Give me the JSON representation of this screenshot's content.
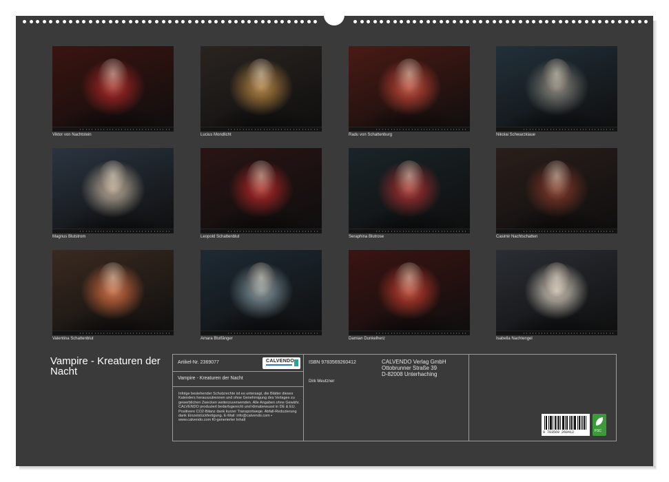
{
  "calendar": {
    "title": "Vampire - Kreaturen der Nacht"
  },
  "thumbnails": [
    {
      "name": "Viktor von Nachtstein",
      "bg": "#3a1410",
      "accent": "#b82828"
    },
    {
      "name": "Lucius Mondlicht",
      "bg": "#2a2420",
      "accent": "#c08a40"
    },
    {
      "name": "Radu von Schattenburg",
      "bg": "#4a1a14",
      "accent": "#d24a3a"
    },
    {
      "name": "Nikolai Schwarzklaue",
      "bg": "#22303a",
      "accent": "#8a8a80"
    },
    {
      "name": "Magnus Blutstrom",
      "bg": "#2a3440",
      "accent": "#c6b6a0"
    },
    {
      "name": "Leopold Schattenblut",
      "bg": "#2a1414",
      "accent": "#c02828"
    },
    {
      "name": "Seraphina Blutrose",
      "bg": "#1a2428",
      "accent": "#b83030"
    },
    {
      "name": "Casimir Nachtschatten",
      "bg": "#2a1e1a",
      "accent": "#8a3a2a"
    },
    {
      "name": "Valentina Schattenblut",
      "bg": "#3a2a20",
      "accent": "#e07040"
    },
    {
      "name": "Amara Blutfänger",
      "bg": "#1e2a34",
      "accent": "#8aa0a8"
    },
    {
      "name": "Damian Dunkelherz",
      "bg": "#3a1412",
      "accent": "#d04030"
    },
    {
      "name": "Isabella Nachtengel",
      "bg": "#2a2e34",
      "accent": "#e0d8c8"
    }
  ],
  "info_box": {
    "article_label": "Artikel-Nr. 2369077",
    "publisher_logo": "CALVENDO",
    "publisher_tagline": "Mein Kalenderverlag",
    "product_title": "Vampire - Kreaturen der Nacht",
    "disclaimer": "Infolge bestehender Schutzrechte ist es untersagt, die Blätter dieses Kalenders herauszutrennen und ohne Genehmigung des Verlages zu gewerblichen Zwecken weiterzuverwenden. Alle Angaben ohne Gewähr. CALVENDO produziert bedarfsgerecht und klimabewusst in DE & EU. Positivere CO2-Bilanz dank kurzer Transportwege. Abfall-Reduzierung dank Einzelstückfertigung. E-Mail: info@calvendo.com • www.calvendo.com KI-generierter Inhalt",
    "isbn": "ISBN 9783569260412",
    "author": "Dirk Meutzner",
    "company": "CALVENDO Verlag GmbH",
    "street": "Ottobrunner Straße 39",
    "city": "D-82008 Unterhaching",
    "barcode_number": "9 783569 260412",
    "eco_label": "FSC"
  },
  "colors": {
    "page_background": "#3a3a3a",
    "border": "#9c9c9c",
    "text": "#e6e6e6"
  }
}
